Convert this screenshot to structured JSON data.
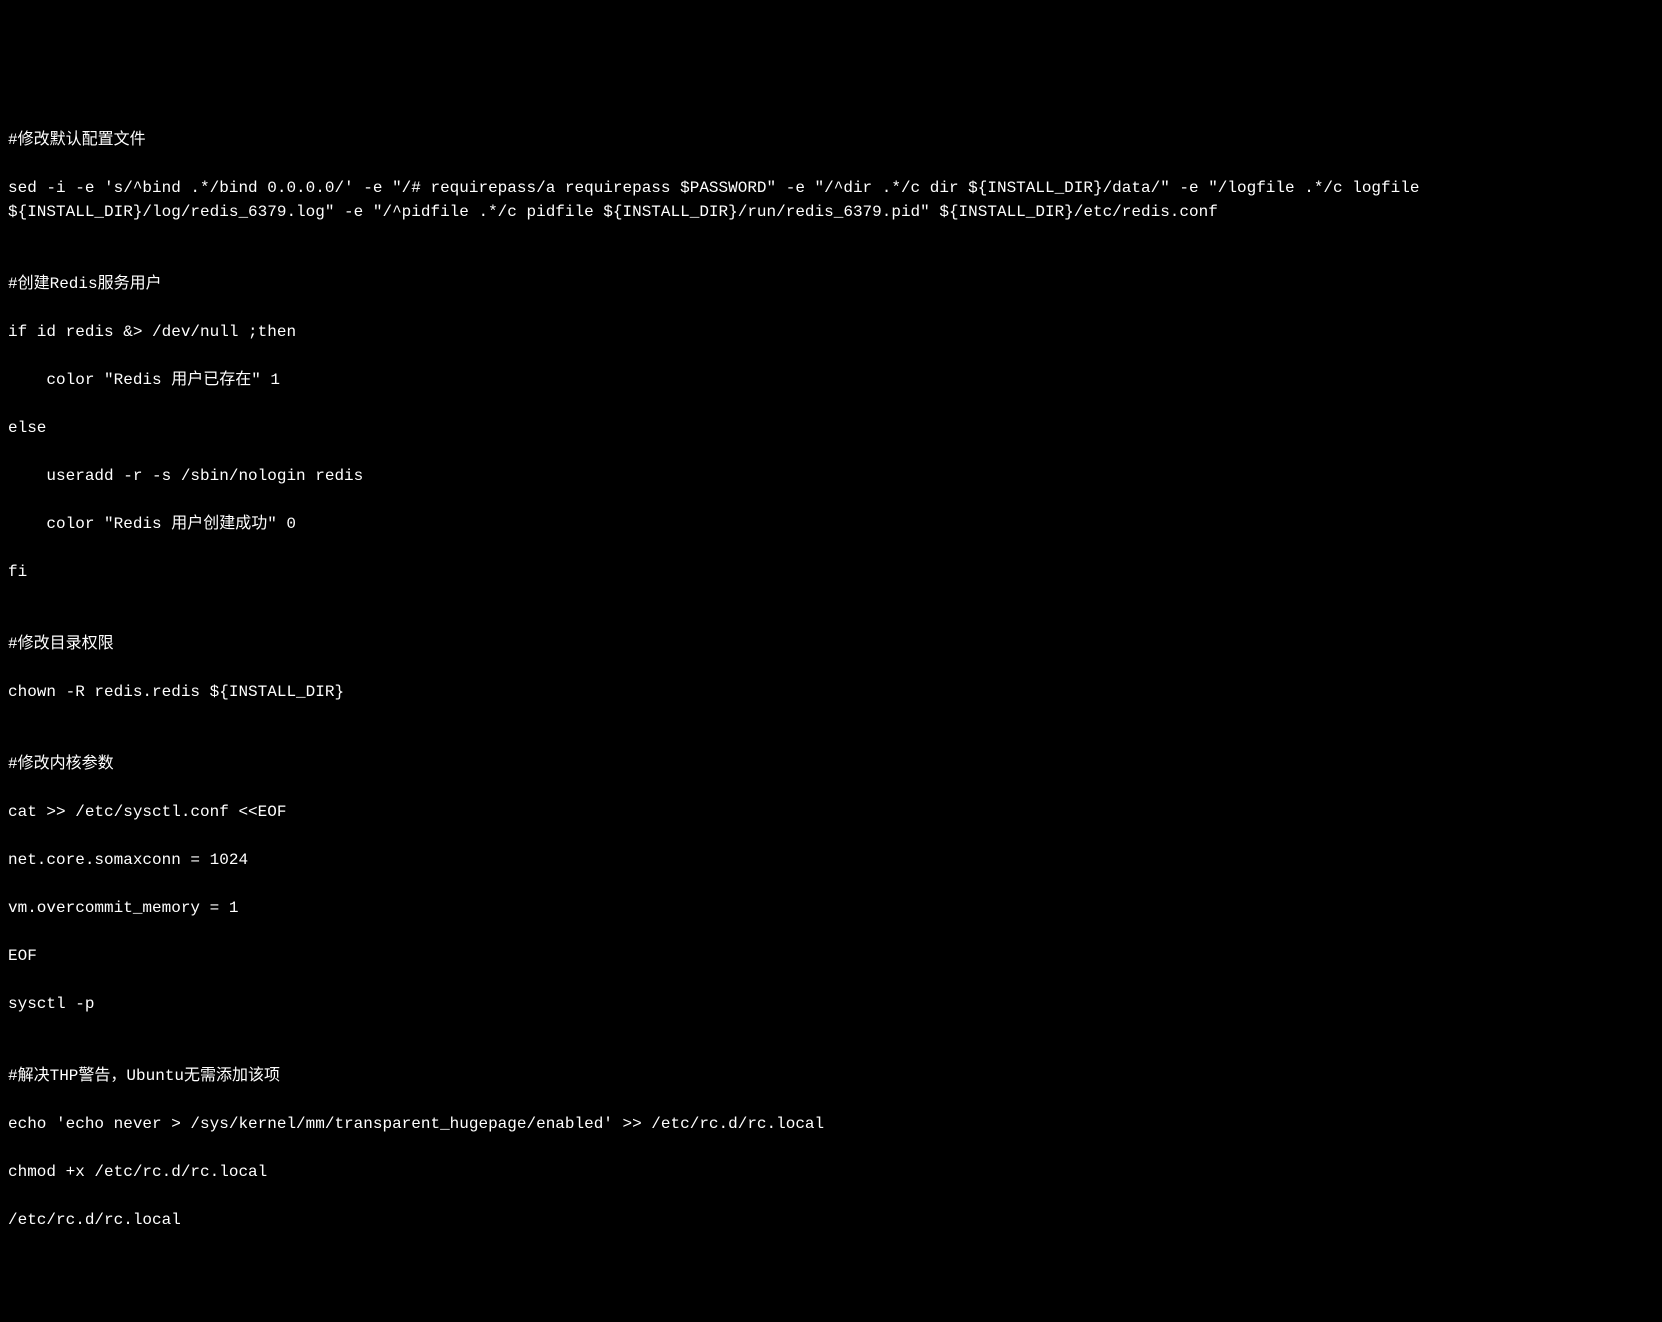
{
  "terminal": {
    "lines": [
      "#修改默认配置文件",
      "sed -i -e 's/^bind .*/bind 0.0.0.0/' -e \"/# requirepass/a requirepass $PASSWORD\" -e \"/^dir .*/c dir ${INSTALL_DIR}/data/\" -e \"/logfile .*/c logfile ${INSTALL_DIR}/log/redis_6379.log\" -e \"/^pidfile .*/c pidfile ${INSTALL_DIR}/run/redis_6379.pid\" ${INSTALL_DIR}/etc/redis.conf",
      "",
      "#创建Redis服务用户",
      "if id redis &> /dev/null ;then",
      "    color \"Redis 用户已存在\" 1",
      "else",
      "    useradd -r -s /sbin/nologin redis",
      "    color \"Redis 用户创建成功\" 0",
      "fi",
      "",
      "#修改目录权限",
      "chown -R redis.redis ${INSTALL_DIR}",
      "",
      "#修改内核参数",
      "cat >> /etc/sysctl.conf <<EOF",
      "net.core.somaxconn = 1024",
      "vm.overcommit_memory = 1",
      "EOF",
      "sysctl -p",
      "",
      "#解决THP警告，Ubuntu无需添加该项",
      "echo 'echo never > /sys/kernel/mm/transparent_hugepage/enabled' >> /etc/rc.d/rc.local",
      "chmod +x /etc/rc.d/rc.local",
      "/etc/rc.d/rc.local"
    ]
  }
}
